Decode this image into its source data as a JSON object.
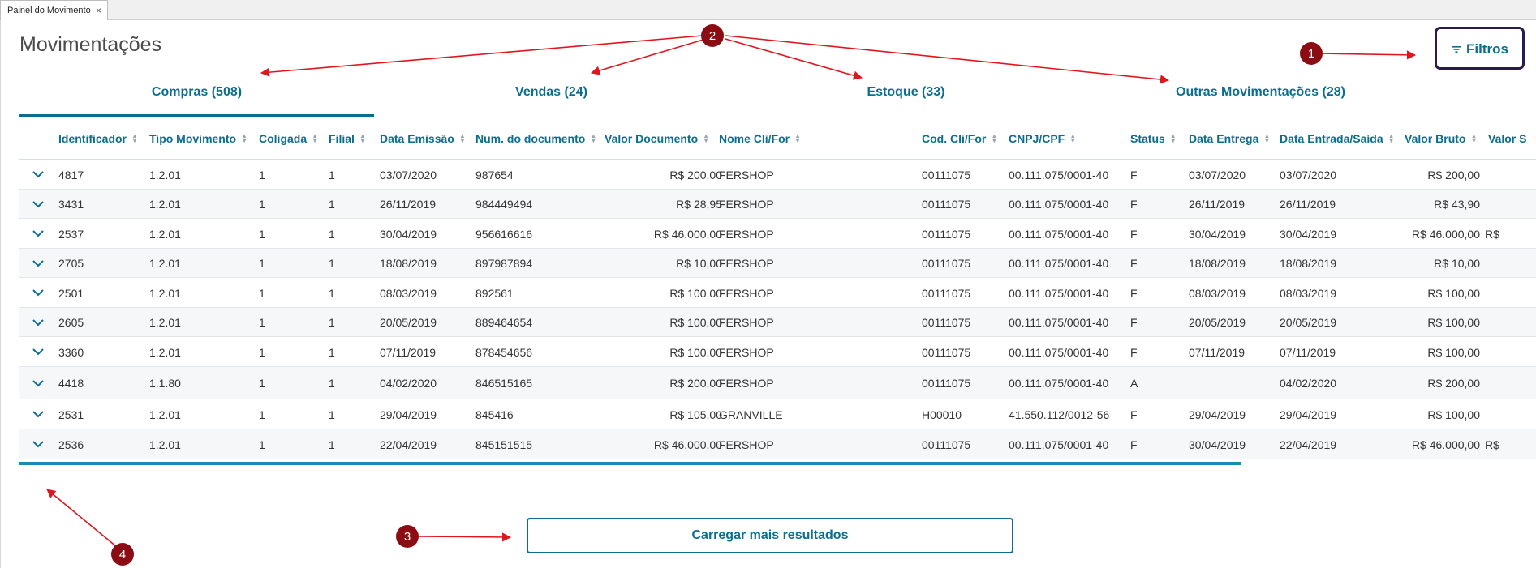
{
  "window_tab": {
    "label": "Painel do Movimento",
    "close": "×"
  },
  "page": {
    "title": "Movimentações"
  },
  "filters_button": {
    "label": "Filtros",
    "icon": "filter-icon"
  },
  "tabs": [
    {
      "label": "Compras (508)",
      "active": true
    },
    {
      "label": "Vendas (24)",
      "active": false
    },
    {
      "label": "Estoque (33)",
      "active": false
    },
    {
      "label": "Outras Movimentações (28)",
      "active": false
    }
  ],
  "table": {
    "columns": [
      "Identificador",
      "Tipo Movimento",
      "Coligada",
      "Filial",
      "Data Emissão",
      "Num. do documento",
      "Valor Documento",
      "Nome Cli/For",
      "Cod. Cli/For",
      "CNPJ/CPF",
      "Status",
      "Data Entrega",
      "Data Entrada/Saída",
      "Valor Bruto",
      "Valor S"
    ],
    "rows": [
      [
        "4817",
        "1.2.01",
        "1",
        "1",
        "03/07/2020",
        "987654",
        "R$ 200,00",
        "FERSHOP",
        "00111075",
        "00.111.075/0001-40",
        "F",
        "03/07/2020",
        "03/07/2020",
        "R$ 200,00",
        ""
      ],
      [
        "3431",
        "1.2.01",
        "1",
        "1",
        "26/11/2019",
        "984449494",
        "R$ 28,95",
        "FERSHOP",
        "00111075",
        "00.111.075/0001-40",
        "F",
        "26/11/2019",
        "26/11/2019",
        "R$ 43,90",
        ""
      ],
      [
        "2537",
        "1.2.01",
        "1",
        "1",
        "30/04/2019",
        "956616616",
        "R$ 46.000,00",
        "FERSHOP",
        "00111075",
        "00.111.075/0001-40",
        "F",
        "30/04/2019",
        "30/04/2019",
        "R$ 46.000,00",
        "R$"
      ],
      [
        "2705",
        "1.2.01",
        "1",
        "1",
        "18/08/2019",
        "897987894",
        "R$ 10,00",
        "FERSHOP",
        "00111075",
        "00.111.075/0001-40",
        "F",
        "18/08/2019",
        "18/08/2019",
        "R$ 10,00",
        ""
      ],
      [
        "2501",
        "1.2.01",
        "1",
        "1",
        "08/03/2019",
        "892561",
        "R$ 100,00",
        "FERSHOP",
        "00111075",
        "00.111.075/0001-40",
        "F",
        "08/03/2019",
        "08/03/2019",
        "R$ 100,00",
        ""
      ],
      [
        "2605",
        "1.2.01",
        "1",
        "1",
        "20/05/2019",
        "889464654",
        "R$ 100,00",
        "FERSHOP",
        "00111075",
        "00.111.075/0001-40",
        "F",
        "20/05/2019",
        "20/05/2019",
        "R$ 100,00",
        ""
      ],
      [
        "3360",
        "1.2.01",
        "1",
        "1",
        "07/11/2019",
        "878454656",
        "R$ 100,00",
        "FERSHOP",
        "00111075",
        "00.111.075/0001-40",
        "F",
        "07/11/2019",
        "07/11/2019",
        "R$ 100,00",
        ""
      ],
      [
        "4418",
        "1.1.80",
        "1",
        "1",
        "04/02/2020",
        "846515165",
        "R$ 200,00",
        "FERSHOP",
        "00111075",
        "00.111.075/0001-40",
        "A",
        "",
        "04/02/2020",
        "R$ 200,00",
        ""
      ],
      [
        "2531",
        "1.2.01",
        "1",
        "1",
        "29/04/2019",
        "845416",
        "R$ 105,00",
        "GRANVILLE",
        "H00010",
        "41.550.112/0012-56",
        "F",
        "29/04/2019",
        "29/04/2019",
        "R$ 100,00",
        ""
      ],
      [
        "2536",
        "1.2.01",
        "1",
        "1",
        "22/04/2019",
        "845151515",
        "R$ 46.000,00",
        "FERSHOP",
        "00111075",
        "00.111.075/0001-40",
        "F",
        "30/04/2019",
        "22/04/2019",
        "R$ 46.000,00",
        "R$"
      ]
    ]
  },
  "load_more": {
    "label": "Carregar mais resultados"
  },
  "annotations": [
    {
      "number": "1"
    },
    {
      "number": "2"
    },
    {
      "number": "3"
    },
    {
      "number": "4"
    }
  ],
  "colors": {
    "accent": "#0c6e8f",
    "marker": "#8b0d13",
    "arrow": "#e0161e",
    "frame": "#2a1a4e"
  }
}
